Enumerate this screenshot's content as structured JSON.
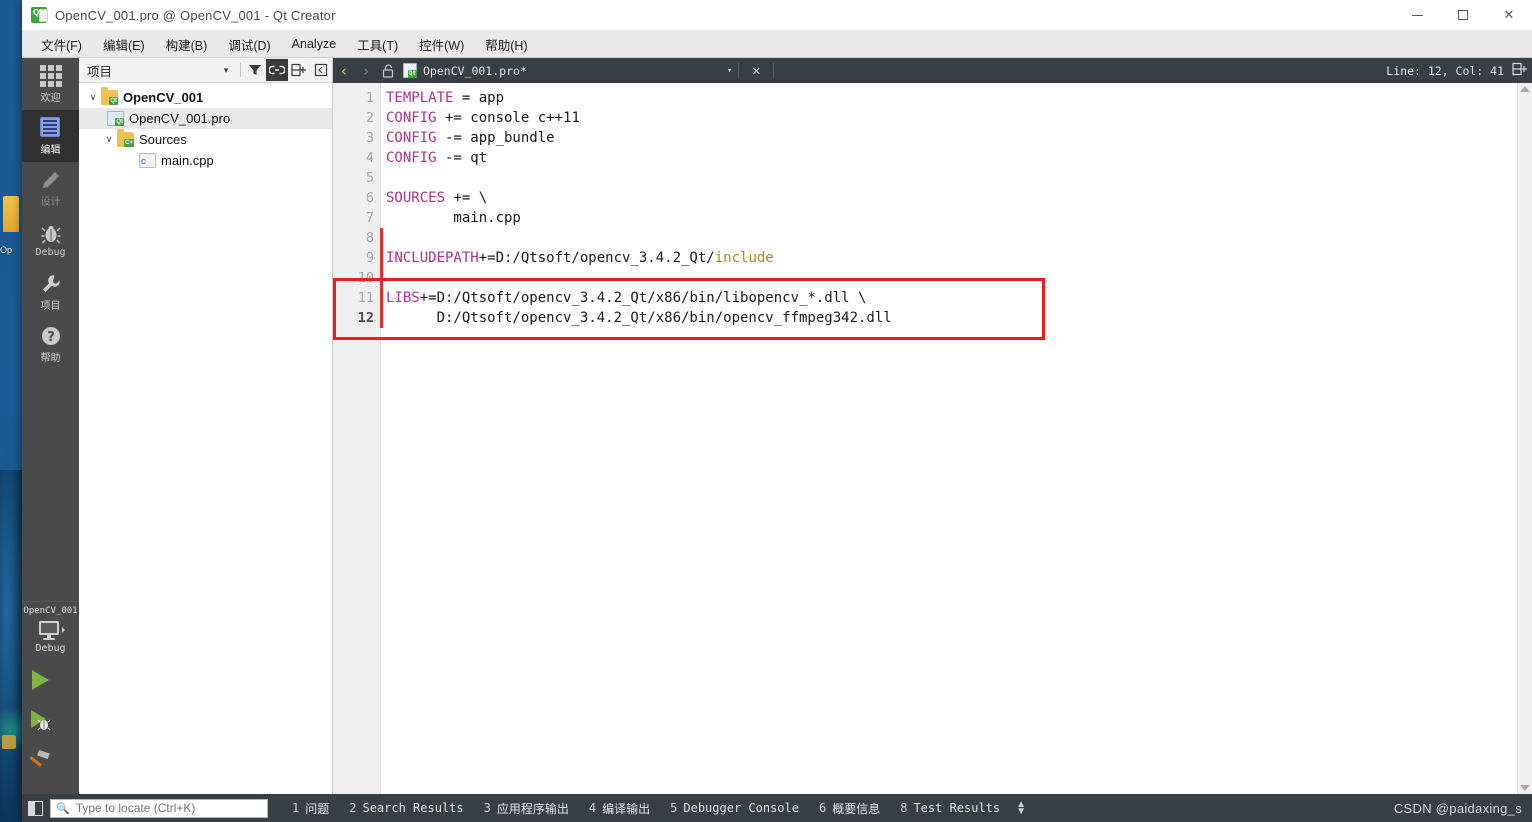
{
  "window": {
    "title": "OpenCV_001.pro @ OpenCV_001 - Qt Creator",
    "logo_text": "Qt",
    "controls": {
      "minimize": "minimize-button",
      "maximize": "maximize-button",
      "close": "✕"
    }
  },
  "menu": {
    "items": [
      {
        "label": "文件(F)",
        "mnemonic": "F"
      },
      {
        "label": "编辑(E)",
        "mnemonic": "E"
      },
      {
        "label": "构建(B)",
        "mnemonic": "B"
      },
      {
        "label": "调试(D)",
        "mnemonic": "D"
      },
      {
        "label": "Analyze",
        "mnemonic": "A"
      },
      {
        "label": "工具(T)",
        "mnemonic": "T"
      },
      {
        "label": "控件(W)",
        "mnemonic": "W"
      },
      {
        "label": "帮助(H)",
        "mnemonic": "H"
      }
    ]
  },
  "mode_bar": {
    "items": [
      {
        "label": "欢迎",
        "icon": "grid-icon",
        "state": "normal"
      },
      {
        "label": "编辑",
        "icon": "document-lines-icon",
        "state": "active"
      },
      {
        "label": "设计",
        "icon": "pencil-icon",
        "state": "disabled"
      },
      {
        "label": "Debug",
        "icon": "bug-icon",
        "state": "normal"
      },
      {
        "label": "项目",
        "icon": "wrench-icon",
        "state": "normal"
      },
      {
        "label": "帮助",
        "icon": "question-circle-icon",
        "state": "normal"
      }
    ],
    "kit": {
      "project_name": "OpenCV_001",
      "build_config": "Debug",
      "target_icon": "monitor-icon",
      "run_icon": "green-play-triangle",
      "debug_icon": "green-play-with-bug",
      "build_icon": "hammer-icon"
    }
  },
  "project_panel": {
    "title": "项目",
    "tools": [
      {
        "name": "filter-dropdown-arrow",
        "glyph": "▾"
      },
      {
        "name": "filter-icon",
        "glyph": "filter"
      },
      {
        "name": "link-with-editor-icon",
        "glyph": "link",
        "active": true
      },
      {
        "name": "split-add-icon",
        "glyph": "split"
      },
      {
        "name": "collapse-panel-icon",
        "glyph": "panel"
      }
    ],
    "tree": [
      {
        "label": "OpenCV_001",
        "depth": 0,
        "icon": "qt-project-folder-icon",
        "arrow": "∨",
        "bold": true,
        "selected": false
      },
      {
        "label": "OpenCV_001.pro",
        "depth": 1,
        "icon": "qt-pro-file-icon",
        "arrow": "",
        "bold": false,
        "selected": true
      },
      {
        "label": "Sources",
        "depth": 1,
        "icon": "cpp-folder-icon",
        "arrow": "∨",
        "bold": false,
        "selected": false
      },
      {
        "label": "main.cpp",
        "depth": 2,
        "icon": "cpp-file-icon",
        "arrow": "",
        "bold": false,
        "selected": false
      }
    ]
  },
  "editor_toolbar": {
    "back": "‹",
    "forward": "›",
    "lock_icon": "unlocked-padlock-icon",
    "file_name": "OpenCV_001.pro*",
    "dropdown": "▾",
    "close": "✕",
    "line_col": "Line: 12, Col: 41",
    "split_icon": "split-editor-icon"
  },
  "code": {
    "lines": [
      {
        "n": 1,
        "tokens": [
          {
            "t": "TEMPLATE",
            "c": "kw"
          },
          {
            "t": " = app",
            "c": ""
          }
        ]
      },
      {
        "n": 2,
        "tokens": [
          {
            "t": "CONFIG",
            "c": "kw"
          },
          {
            "t": " += console c++11",
            "c": ""
          }
        ]
      },
      {
        "n": 3,
        "tokens": [
          {
            "t": "CONFIG",
            "c": "kw"
          },
          {
            "t": " -= app_bundle",
            "c": ""
          }
        ]
      },
      {
        "n": 4,
        "tokens": [
          {
            "t": "CONFIG",
            "c": "kw"
          },
          {
            "t": " -= qt",
            "c": ""
          }
        ]
      },
      {
        "n": 5,
        "tokens": []
      },
      {
        "n": 6,
        "tokens": [
          {
            "t": "SOURCES",
            "c": "kw"
          },
          {
            "t": " += \\",
            "c": ""
          }
        ]
      },
      {
        "n": 7,
        "tokens": [
          {
            "t": "        main.cpp",
            "c": ""
          }
        ]
      },
      {
        "n": 8,
        "tokens": []
      },
      {
        "n": 9,
        "tokens": [
          {
            "t": "INCLUDEPATH",
            "c": "kw"
          },
          {
            "t": "+=D:/Qtsoft/opencv_3.4.2_Qt/",
            "c": ""
          },
          {
            "t": "include",
            "c": "str"
          }
        ]
      },
      {
        "n": 10,
        "tokens": []
      },
      {
        "n": 11,
        "tokens": [
          {
            "t": "LIBS",
            "c": "kw"
          },
          {
            "t": "+=D:/Qtsoft/opencv_3.4.2_Qt/x86/bin/libopencv_*.dll \\",
            "c": ""
          }
        ]
      },
      {
        "n": 12,
        "tokens": [
          {
            "t": "      D:/Qtsoft/opencv_3.4.2_Qt/x86/bin/opencv_ffmpeg342.dll",
            "c": ""
          }
        ],
        "current": true
      }
    ],
    "annotation": {
      "name": "red-highlight-box",
      "color": "#ee1c1c",
      "covers_lines": [
        11,
        12
      ]
    },
    "change_bar_color": "#e03030"
  },
  "status_bar": {
    "panel_toggle": "toggle-sidebar-button",
    "locator_placeholder": "Type to locate (Ctrl+K)",
    "locator_value": "",
    "locator_icon": "search-icon",
    "panes": [
      {
        "num": "1",
        "label": "问题",
        "mono": false
      },
      {
        "num": "2",
        "label": "Search Results",
        "mono": true
      },
      {
        "num": "3",
        "label": "应用程序输出",
        "mono": false
      },
      {
        "num": "4",
        "label": "编译输出",
        "mono": false
      },
      {
        "num": "5",
        "label": "Debugger Console",
        "mono": true
      },
      {
        "num": "6",
        "label": "概要信息",
        "mono": false
      },
      {
        "num": "8",
        "label": "Test Results",
        "mono": true
      }
    ],
    "updown_icon": "up-down-arrows-icon",
    "watermark": "CSDN @paidaxing_s"
  },
  "desktop": {
    "folder_icon": "yellow-folder-icon",
    "icon_label": "Op"
  }
}
